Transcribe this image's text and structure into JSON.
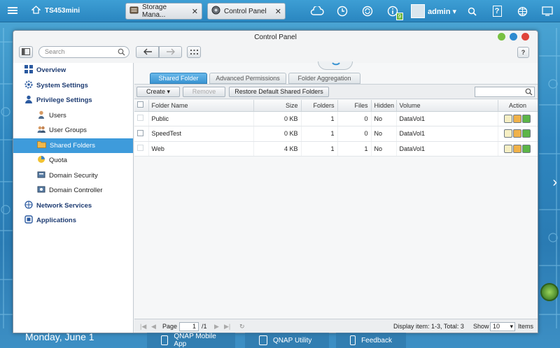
{
  "topbar": {
    "host_name": "TS453mini",
    "tabs": [
      {
        "label": "Storage Mana...",
        "icon": "storage-icon"
      },
      {
        "label": "Control Panel",
        "icon": "control-panel-icon"
      }
    ],
    "user": "admin",
    "notification_count": "9"
  },
  "window": {
    "title": "Control Panel",
    "search_placeholder": "Search"
  },
  "sidebar": {
    "items": [
      {
        "label": "Overview",
        "level": "top"
      },
      {
        "label": "System Settings",
        "level": "top"
      },
      {
        "label": "Privilege Settings",
        "level": "top"
      },
      {
        "label": "Users",
        "level": "sub"
      },
      {
        "label": "User Groups",
        "level": "sub"
      },
      {
        "label": "Shared Folders",
        "level": "sub",
        "active": true
      },
      {
        "label": "Quota",
        "level": "sub"
      },
      {
        "label": "Domain Security",
        "level": "sub"
      },
      {
        "label": "Domain Controller",
        "level": "sub"
      },
      {
        "label": "Network Services",
        "level": "top"
      },
      {
        "label": "Applications",
        "level": "top"
      }
    ]
  },
  "tabs": [
    "Shared Folder",
    "Advanced Permissions",
    "Folder Aggregation"
  ],
  "actions": {
    "create": "Create",
    "remove": "Remove",
    "restore": "Restore Default Shared Folders"
  },
  "table": {
    "columns": [
      "Folder Name",
      "Size",
      "Folders",
      "Files",
      "Hidden",
      "Volume",
      "Action"
    ],
    "rows": [
      {
        "name": "Public",
        "size": "0 KB",
        "folders": "1",
        "files": "0",
        "hidden": "No",
        "volume": "DataVol1"
      },
      {
        "name": "SpeedTest",
        "size": "0 KB",
        "folders": "1",
        "files": "0",
        "hidden": "No",
        "volume": "DataVol1"
      },
      {
        "name": "Web",
        "size": "4 KB",
        "folders": "1",
        "files": "1",
        "hidden": "No",
        "volume": "DataVol1"
      }
    ]
  },
  "pager": {
    "page_label": "Page",
    "page_value": "1",
    "page_total": "/1",
    "display_text": "Display item: 1-3, Total: 3",
    "show_label": "Show",
    "per_page": "10",
    "items_label": "Items"
  },
  "desktop": {
    "date": "Monday, June 1",
    "dock": [
      "QNAP Mobile App",
      "QNAP Utility",
      "Feedback"
    ]
  },
  "colors": {
    "accent": "#3e9bdb",
    "desktop": "#2e86bf"
  }
}
